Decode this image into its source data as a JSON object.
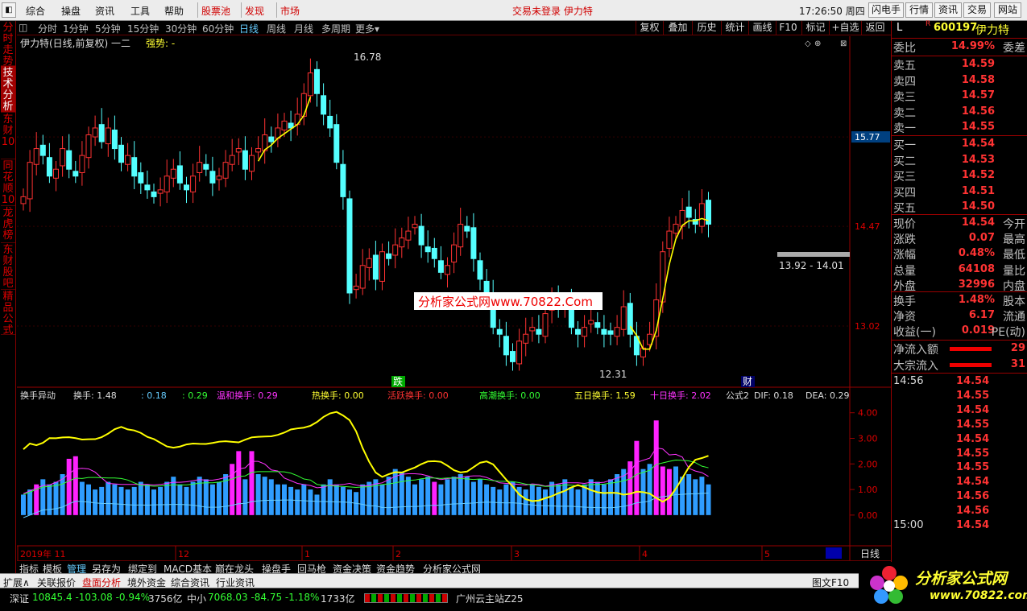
{
  "menu": {
    "items": [
      "综合",
      "操盘",
      "资讯",
      "工具",
      "帮助"
    ],
    "red_items": [
      "股票池",
      "发现",
      "市场"
    ],
    "notice": "交易未登录  伊力特",
    "clock": "17:26:50 周四",
    "right_buttons": [
      "闪电手",
      "行情",
      "资讯",
      "交易",
      "网站"
    ]
  },
  "side_tabs": [
    "分时走势",
    "技术分析",
    "东财10",
    "同花顺10",
    "龙虎榜",
    "东财股吧",
    "精品公式"
  ],
  "period_tabs": [
    "分时",
    "1分钟",
    "5分钟",
    "15分钟",
    "30分钟",
    "60分钟",
    "日线",
    "周线",
    "月线",
    "多周期",
    "更多▾"
  ],
  "toolbar": [
    "复权",
    "叠加",
    "历史",
    "统计",
    "画线",
    "F10",
    "标记",
    "+自选",
    "返回"
  ],
  "kline_header": {
    "title": "伊力特(日线,前复权)",
    "extra": "一二",
    "strength": "强势: -"
  },
  "kline_labels": {
    "high": "16.78",
    "low": "12.31",
    "range": "13.92 - 14.01",
    "watermark": "分析家公式网www.70822.Com",
    "mark_drop": "跌",
    "mark_cai": "财"
  },
  "price_axis": [
    "15.77",
    "14.47",
    "13.02"
  ],
  "indicator_header": {
    "name": "换手异动",
    "turnover": "换手: 1.48",
    "v1": ": 0.18",
    "v2": ": 0.29",
    "mild": "温和换手: 0.29",
    "hot": "热换手: 0.00",
    "active": "活跃换手: 0.00",
    "climax": "高潮换手: 0.00",
    "five": "五日换手: 1.59",
    "ten": "十日换手: 2.02",
    "formula": "公式2",
    "dif": "DIF: 0.18",
    "dea": "DEA: 0.29"
  },
  "indicator_axis": [
    "4.00",
    "3.00",
    "2.00",
    "1.00",
    "0.00"
  ],
  "time_axis": [
    "2019年 11",
    "12",
    "1",
    "2",
    "3",
    "4",
    "5"
  ],
  "time_axis_right": "日线",
  "bottom_tabs": [
    "指标",
    "模板",
    "管理",
    "另存为",
    "绑定到",
    "MACD基本",
    "巅在龙头",
    "操盘手",
    "回马枪",
    "资金决策",
    "资金趋势",
    "分析家公式网"
  ],
  "row2": [
    "扩展∧",
    "关联报价",
    "盘面分析",
    "境外资金",
    "综合资讯",
    "行业资讯"
  ],
  "row2_right": "图文F10",
  "status": {
    "sz_label": "深证",
    "sz_values": "10845.4  -103.08  -0.94%",
    "sz_amount": "3756亿",
    "zx_label": "中小",
    "zx_values": "7068.03  -84.75  -1.18%",
    "zx_amount": "1733亿",
    "server": "广州云主站Z25"
  },
  "quote": {
    "code": "600197",
    "name": "伊力特",
    "mark": "L",
    "r": "R",
    "weibi": {
      "label": "委比",
      "value": "14.99%",
      "right": "委差"
    },
    "asks": [
      {
        "label": "卖五",
        "price": "14.59"
      },
      {
        "label": "卖四",
        "price": "14.58"
      },
      {
        "label": "卖三",
        "price": "14.57"
      },
      {
        "label": "卖二",
        "price": "14.56"
      },
      {
        "label": "卖一",
        "price": "14.55"
      }
    ],
    "bids": [
      {
        "label": "买一",
        "price": "14.54"
      },
      {
        "label": "买二",
        "price": "14.53"
      },
      {
        "label": "买三",
        "price": "14.52"
      },
      {
        "label": "买四",
        "price": "14.51"
      },
      {
        "label": "买五",
        "price": "14.50"
      }
    ],
    "stats": [
      {
        "label": "现价",
        "value": "14.54",
        "right": "今开"
      },
      {
        "label": "涨跌",
        "value": "0.07",
        "right": "最高"
      },
      {
        "label": "涨幅",
        "value": "0.48%",
        "right": "最低"
      },
      {
        "label": "总量",
        "value": "64108",
        "right": "量比"
      },
      {
        "label": "外盘",
        "value": "32996",
        "right": "内盘"
      }
    ],
    "stats2": [
      {
        "label": "换手",
        "value": "1.48%",
        "right": "股本"
      },
      {
        "label": "净资",
        "value": "6.17",
        "right": "流通"
      },
      {
        "label": "收益(一)",
        "value": "0.019",
        "right": "PE(动)"
      }
    ],
    "flows": [
      {
        "label": "净流入额",
        "value": "29"
      },
      {
        "label": "大宗流入",
        "value": "31"
      }
    ],
    "ticks": [
      {
        "time": "14:56",
        "price": "14.54"
      },
      {
        "time": "",
        "price": "14.55"
      },
      {
        "time": "",
        "price": "14.54"
      },
      {
        "time": "",
        "price": "14.55"
      },
      {
        "time": "",
        "price": "14.54"
      },
      {
        "time": "",
        "price": "14.55"
      },
      {
        "time": "",
        "price": "14.55"
      },
      {
        "time": "",
        "price": "14.54"
      },
      {
        "time": "",
        "price": "14.56"
      },
      {
        "time": "",
        "price": "14.56"
      },
      {
        "time": "15:00",
        "price": "14.54"
      }
    ]
  },
  "logo": {
    "text": "分析家公式网",
    "url": "www.70822.com"
  },
  "chart_data": {
    "type": "candlestick",
    "closes": [
      14.9,
      15.4,
      15.6,
      15.5,
      15.2,
      15.3,
      15.6,
      15.3,
      15.2,
      15.5,
      15.8,
      15.9,
      15.7,
      15.9,
      15.6,
      15.4,
      15.5,
      15.2,
      15.1,
      15.0,
      14.9,
      15.0,
      15.2,
      15.3,
      15.1,
      15.0,
      15.2,
      15.4,
      15.3,
      15.1,
      15.2,
      15.4,
      15.5,
      15.6,
      15.3,
      15.5,
      15.6,
      15.8,
      15.7,
      15.9,
      16.0,
      15.9,
      16.1,
      16.4,
      16.7,
      16.4,
      16.1,
      15.9,
      15.4,
      14.9,
      13.5,
      13.6,
      13.9,
      14.0,
      13.7,
      14.1,
      14.0,
      14.2,
      14.3,
      14.4,
      14.5,
      14.2,
      14.1,
      14.0,
      13.8,
      13.9,
      14.2,
      14.5,
      14.4,
      14.0,
      13.7,
      13.4,
      13.0,
      12.9,
      12.6,
      12.5,
      12.8,
      12.9,
      13.0,
      12.9,
      13.2,
      13.4,
      13.3,
      13.3,
      13.0,
      12.9,
      13.0,
      13.1,
      13.0,
      12.9,
      12.9,
      13.0,
      13.3,
      12.9,
      12.6,
      12.7,
      12.9,
      13.4,
      14.1,
      14.4,
      14.5,
      14.7,
      14.6,
      14.5,
      14.8,
      14.5
    ],
    "turnover_bars": [
      0.8,
      1.0,
      1.2,
      1.4,
      1.2,
      1.3,
      1.6,
      2.2,
      2.3,
      1.3,
      1.2,
      1.0,
      1.1,
      1.3,
      1.2,
      1.1,
      1.0,
      1.1,
      1.3,
      1.2,
      1.0,
      1.1,
      1.3,
      1.5,
      1.2,
      1.1,
      1.3,
      1.5,
      1.4,
      1.2,
      1.3,
      1.6,
      2.0,
      2.5,
      1.4,
      2.5,
      1.6,
      1.5,
      1.4,
      1.2,
      1.2,
      1.1,
      1.0,
      1.2,
      1.0,
      0.8,
      1.2,
      1.4,
      1.2,
      1.1,
      1.0,
      0.9,
      1.2,
      1.3,
      1.4,
      1.2,
      1.5,
      1.8,
      1.7,
      1.5,
      1.2,
      1.4,
      1.5,
      1.3,
      1.2,
      1.4,
      1.5,
      1.6,
      1.5,
      1.3,
      1.4,
      1.2,
      1.1,
      1.0,
      1.2,
      1.3,
      1.1,
      1.0,
      1.2,
      1.1,
      1.0,
      1.3,
      1.2,
      1.4,
      1.1,
      1.0,
      1.2,
      1.4,
      1.3,
      1.2,
      1.4,
      1.6,
      1.8,
      2.1,
      2.9,
      1.8,
      2.0,
      3.7,
      1.9,
      1.8,
      1.9,
      1.5,
      1.6,
      1.4,
      1.5,
      1.2
    ],
    "magenta_bar_indices": [
      2,
      7,
      8,
      32,
      33,
      35,
      63,
      93,
      94,
      97,
      98,
      99
    ],
    "ylim_price": [
      12.2,
      17.0
    ],
    "ylim_indicator": [
      -1.2,
      4.4
    ]
  }
}
